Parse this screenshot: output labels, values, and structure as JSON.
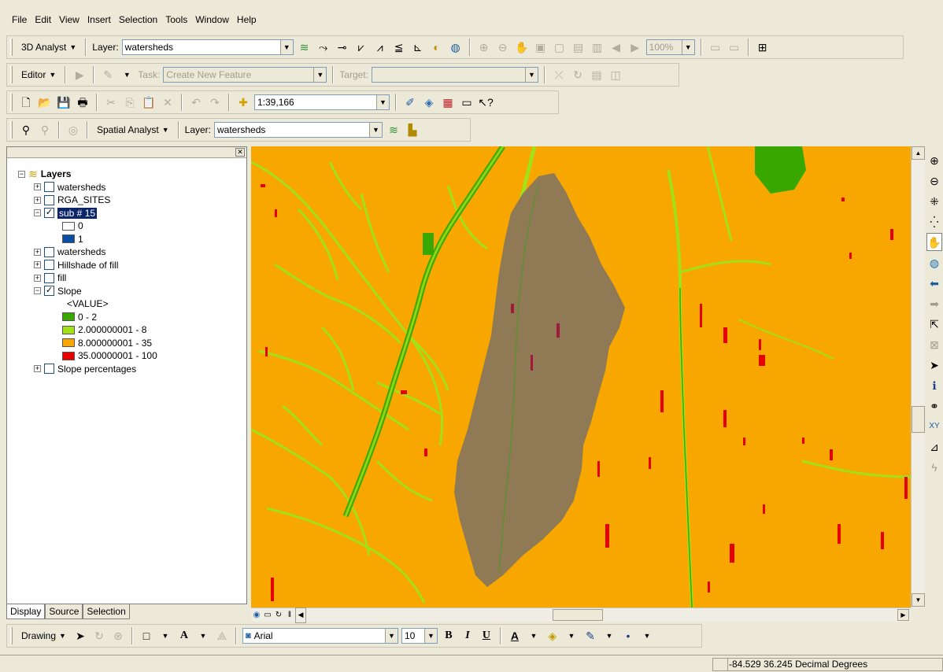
{
  "menu": [
    "File",
    "Edit",
    "View",
    "Insert",
    "Selection",
    "Tools",
    "Window",
    "Help"
  ],
  "toolbar_3d": {
    "dropdown_label": "3D Analyst",
    "layer_label": "Layer:",
    "layer_value": "watersheds",
    "zoom_value": "100%"
  },
  "toolbar_editor": {
    "dropdown_label": "Editor",
    "task_label": "Task:",
    "task_value": "Create New Feature",
    "target_label": "Target:",
    "target_value": ""
  },
  "toolbar_standard": {
    "scale_value": "1:39,166"
  },
  "toolbar_spatial": {
    "dropdown_label": "Spatial Analyst",
    "layer_label": "Layer:",
    "layer_value": "watersheds"
  },
  "toc": {
    "root_label": "Layers",
    "layers": [
      {
        "name": "watersheds",
        "checked": false,
        "expanded": false
      },
      {
        "name": "RGA_SITES",
        "checked": false,
        "expanded": false
      },
      {
        "name": "sub # 15",
        "checked": true,
        "expanded": true,
        "selected": true
      },
      {
        "name": "watersheds",
        "checked": false,
        "expanded": false
      },
      {
        "name": "Hillshade of fill",
        "checked": false,
        "expanded": false
      },
      {
        "name": "fill",
        "checked": false,
        "expanded": false
      },
      {
        "name": "Slope",
        "checked": true,
        "expanded": true
      },
      {
        "name": "Slope percentages",
        "checked": false,
        "expanded": false
      }
    ],
    "sub15_legend": [
      {
        "label": "0",
        "color": "#ffffff"
      },
      {
        "label": "1",
        "color": "#0a4ea3"
      }
    ],
    "slope_field": "<VALUE>",
    "slope_legend": [
      {
        "label": "0 - 2",
        "color": "#38a800"
      },
      {
        "label": "2.000000001 - 8",
        "color": "#a3e01a"
      },
      {
        "label": "8.000000001 - 35",
        "color": "#f7a700"
      },
      {
        "label": "35.00000001 - 100",
        "color": "#e60000"
      }
    ],
    "tabs": [
      "Display",
      "Source",
      "Selection"
    ]
  },
  "drawing_toolbar": {
    "dropdown_label": "Drawing",
    "font_value": "Arial",
    "size_value": "10",
    "bold": "B",
    "italic": "I",
    "underline": "U",
    "font_color_glyph": "A"
  },
  "status": {
    "coordinates": "-84.529  36.245 Decimal Degrees"
  },
  "colors": {
    "map_background": "#f7a700",
    "slope_flat": "#38a800",
    "slope_gentle": "#a3e01a",
    "slope_steep": "#e60000",
    "watershed_overlay": "#8f7a55"
  }
}
